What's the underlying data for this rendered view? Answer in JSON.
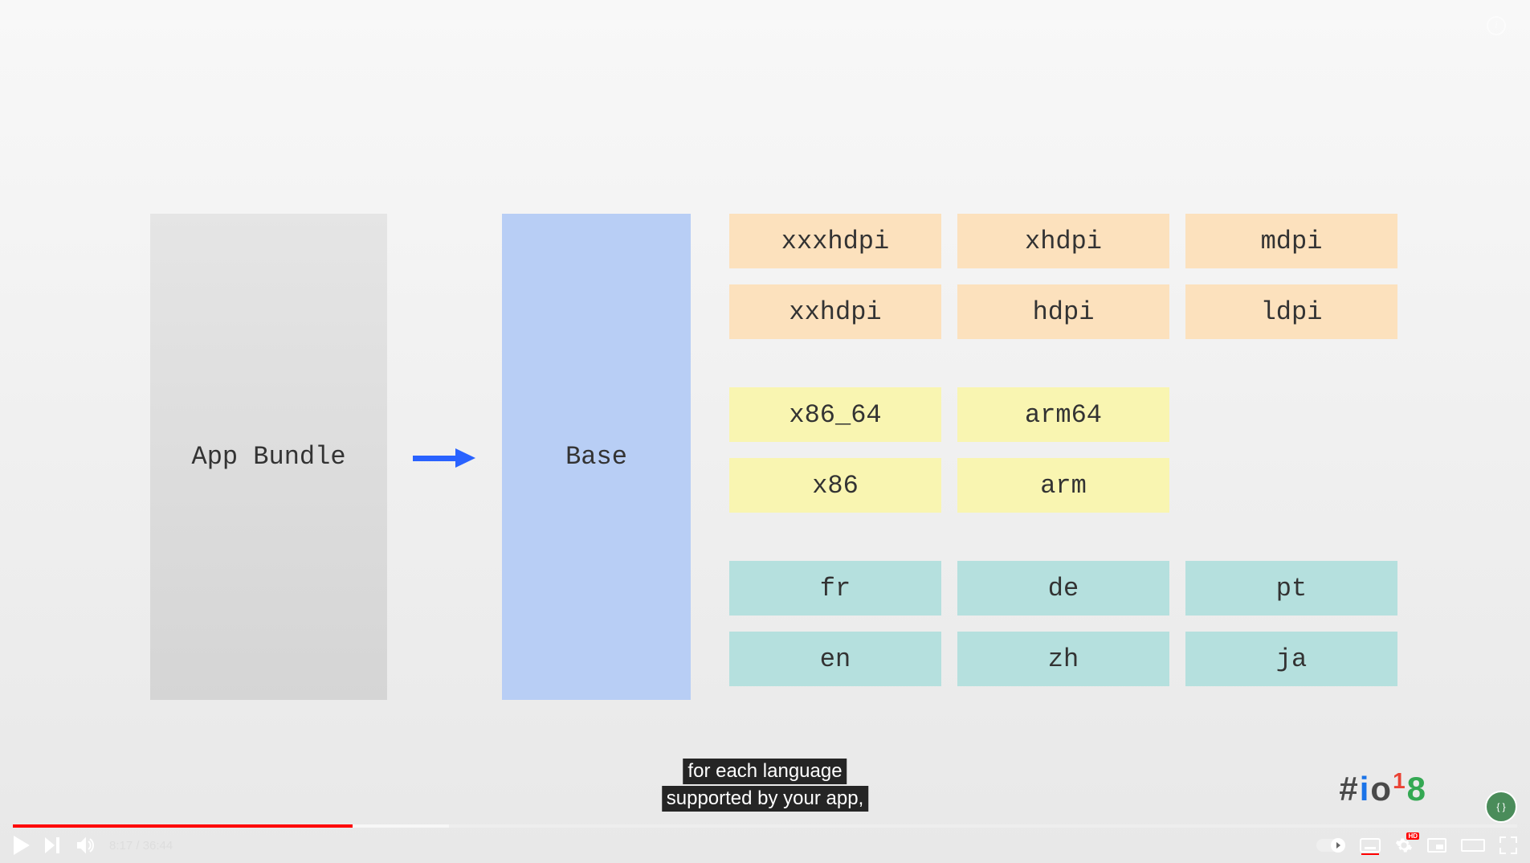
{
  "slide": {
    "app_bundle_label": "App Bundle",
    "base_label": "Base",
    "density": [
      [
        "xxxhdpi",
        "xhdpi",
        "mdpi"
      ],
      [
        "xxhdpi",
        "hdpi",
        "ldpi"
      ]
    ],
    "arch": [
      [
        "x86_64",
        "arm64"
      ],
      [
        "x86",
        "arm"
      ]
    ],
    "lang": [
      [
        "fr",
        "de",
        "pt"
      ],
      [
        "en",
        "zh",
        "ja"
      ]
    ],
    "io_logo": "#io18"
  },
  "caption": {
    "line1": "for each language",
    "line2": "supported by your app,"
  },
  "player": {
    "current_time": "8:17",
    "duration": "36:44",
    "time_display": "8:17 / 36:44",
    "hd_label": "HD"
  }
}
